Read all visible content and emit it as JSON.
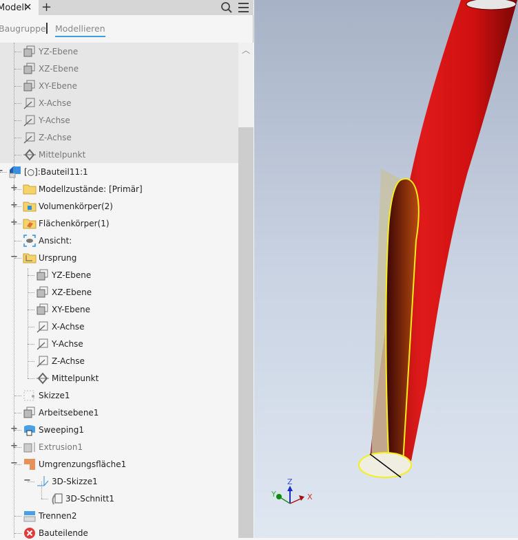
{
  "tabs": {
    "active": "Modell",
    "close": "✕",
    "add": "+"
  },
  "subtabs": {
    "assembly": "Baugruppe",
    "modeling": "Modellieren"
  },
  "tree": [
    {
      "label": "YZ-Ebene",
      "icon": "plane-icon",
      "level": 1,
      "dim": true,
      "section": "top"
    },
    {
      "label": "XZ-Ebene",
      "icon": "plane-icon",
      "level": 1,
      "dim": true,
      "section": "top"
    },
    {
      "label": "XY-Ebene",
      "icon": "plane-icon",
      "level": 1,
      "dim": true,
      "section": "top"
    },
    {
      "label": "X-Achse",
      "icon": "axis-icon",
      "level": 1,
      "dim": true,
      "section": "top"
    },
    {
      "label": "Y-Achse",
      "icon": "axis-icon",
      "level": 1,
      "dim": true,
      "section": "top"
    },
    {
      "label": "Z-Achse",
      "icon": "axis-icon",
      "level": 1,
      "dim": true,
      "section": "top"
    },
    {
      "label": "Mittelpunkt",
      "icon": "point-icon",
      "level": 1,
      "dim": true,
      "section": "top"
    },
    {
      "label": "[○]:Bauteil11:1",
      "icon": "part-icon",
      "level": 0,
      "expander": "−"
    },
    {
      "label": "Modellzustände: [Primär]",
      "icon": "folder-icon",
      "level": 1,
      "expander": "+"
    },
    {
      "label": "Volumenkörper(2)",
      "icon": "solid-bodies-folder-icon",
      "level": 1,
      "expander": "+"
    },
    {
      "label": "Flächenkörper(1)",
      "icon": "surface-bodies-folder-icon",
      "level": 1,
      "expander": "+"
    },
    {
      "label": "Ansicht:",
      "icon": "view-icon",
      "level": 1
    },
    {
      "label": "Ursprung",
      "icon": "origin-folder-icon",
      "level": 1,
      "expander": "−"
    },
    {
      "label": "YZ-Ebene",
      "icon": "plane-icon",
      "level": 2
    },
    {
      "label": "XZ-Ebene",
      "icon": "plane-icon",
      "level": 2
    },
    {
      "label": "XY-Ebene",
      "icon": "plane-icon",
      "level": 2
    },
    {
      "label": "X-Achse",
      "icon": "axis-icon",
      "level": 2
    },
    {
      "label": "Y-Achse",
      "icon": "axis-icon",
      "level": 2
    },
    {
      "label": "Z-Achse",
      "icon": "axis-icon",
      "level": 2
    },
    {
      "label": "Mittelpunkt",
      "icon": "point-icon",
      "level": 2
    },
    {
      "label": "Skizze1",
      "icon": "sketch-icon",
      "level": 1
    },
    {
      "label": "Arbeitsebene1",
      "icon": "plane-icon",
      "level": 1
    },
    {
      "label": "Sweeping1",
      "icon": "sweep-icon",
      "level": 1,
      "expander": "+"
    },
    {
      "label": "Extrusion1",
      "icon": "extrude-icon",
      "level": 1,
      "expander": "+",
      "dim": true
    },
    {
      "label": "Umgrenzungsfläche1",
      "icon": "boundary-patch-icon",
      "level": 1,
      "expander": "−"
    },
    {
      "label": "3D-Skizze1",
      "icon": "3d-sketch-icon",
      "level": 2,
      "expander": "−"
    },
    {
      "label": "3D-Schnitt1",
      "icon": "intersection-curve-icon",
      "level": 3
    },
    {
      "label": "Trennen2",
      "icon": "split-icon",
      "level": 1
    },
    {
      "label": "Bauteilende",
      "icon": "end-of-part-icon",
      "level": 1
    }
  ],
  "triad": {
    "x": "X",
    "y": "Y",
    "z": "Z"
  },
  "colors": {
    "tube": "#d41515",
    "accent": "#3aa0d5",
    "highlight": "#f5f018"
  }
}
